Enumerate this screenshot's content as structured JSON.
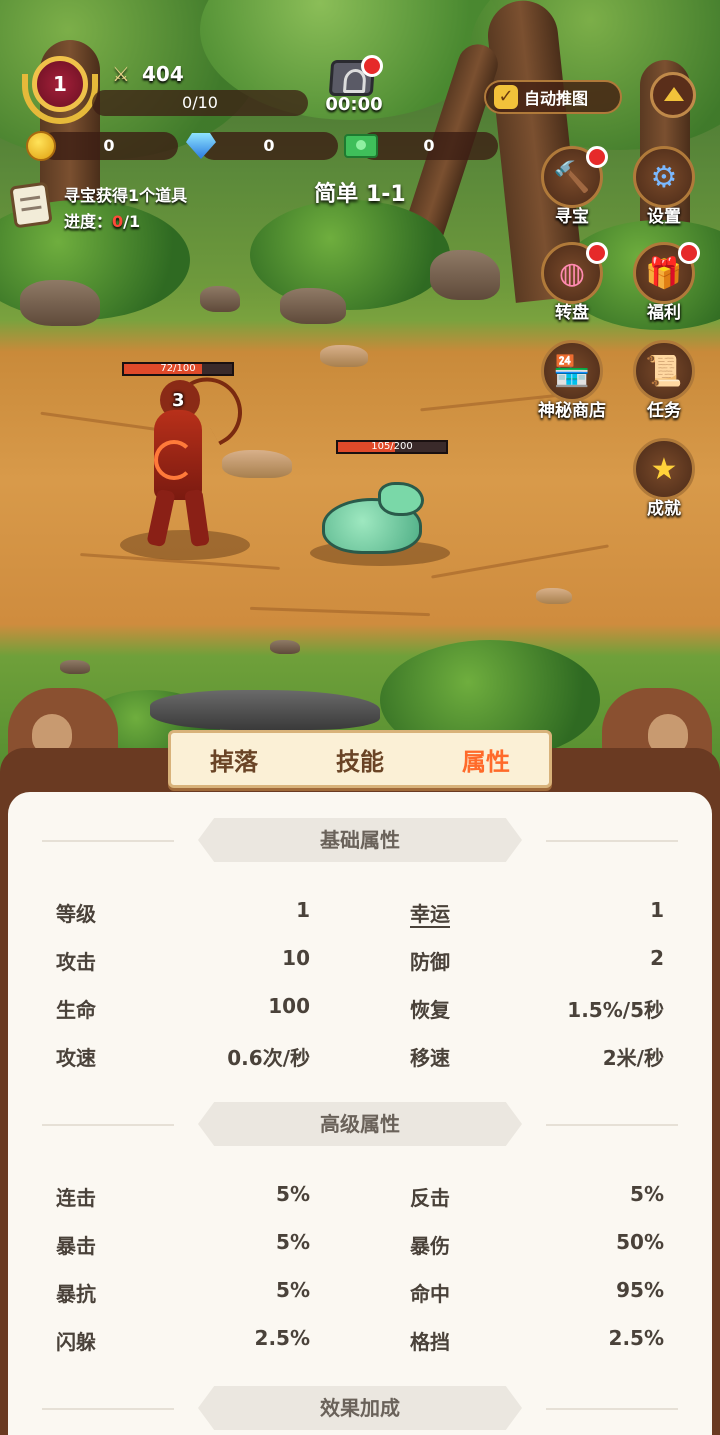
{
  "hud": {
    "level": "1",
    "power": "404",
    "xp": "0/10",
    "timer": "00:00",
    "auto_push_label": "自动推图",
    "currencies": {
      "gold": "0",
      "gems": "0",
      "cash": "0"
    },
    "quest": {
      "text": "寻宝获得1个道具",
      "progress_label": "进度：",
      "progress_current": "0",
      "progress_total": "/1"
    },
    "stage": "简单 1-1"
  },
  "side_menu": [
    {
      "label": "寻宝",
      "icon": "hammer-icon",
      "badge": true
    },
    {
      "label": "设置",
      "icon": "gear-icon",
      "badge": false
    },
    {
      "label": "转盘",
      "icon": "wheel-icon",
      "badge": true
    },
    {
      "label": "福利",
      "icon": "gift-icon",
      "badge": true
    },
    {
      "label": "神秘商店",
      "icon": "shop-icon",
      "badge": false
    },
    {
      "label": "任务",
      "icon": "scroll-icon",
      "badge": false
    },
    {
      "label": "成就",
      "icon": "star-icon",
      "badge": false
    }
  ],
  "battle": {
    "player_hp": "72/100",
    "player_hp_fraction": 0.72,
    "damage_number": "3",
    "enemy_hp": "105/200",
    "enemy_hp_fraction": 0.525
  },
  "tabs": {
    "drop": "掉落",
    "skill": "技能",
    "attr": "属性",
    "active": "属性"
  },
  "sections": {
    "basic": {
      "title": "基础属性",
      "rows": [
        {
          "k1": "等级",
          "v1": "1",
          "k2": "幸运",
          "v2": "1"
        },
        {
          "k1": "攻击",
          "v1": "10",
          "k2": "防御",
          "v2": "2"
        },
        {
          "k1": "生命",
          "v1": "100",
          "k2": "恢复",
          "v2": "1.5%/5秒"
        },
        {
          "k1": "攻速",
          "v1": "0.6次/秒",
          "k2": "移速",
          "v2": "2米/秒"
        }
      ]
    },
    "advanced": {
      "title": "高级属性",
      "rows": [
        {
          "k1": "连击",
          "v1": "5%",
          "k2": "反击",
          "v2": "5%"
        },
        {
          "k1": "暴击",
          "v1": "5%",
          "k2": "暴伤",
          "v2": "50%"
        },
        {
          "k1": "暴抗",
          "v1": "5%",
          "k2": "命中",
          "v2": "95%"
        },
        {
          "k1": "闪躲",
          "v1": "2.5%",
          "k2": "格挡",
          "v2": "2.5%"
        }
      ]
    },
    "bonus": {
      "title": "效果加成"
    }
  },
  "colors": {
    "accent": "#ff6a2a",
    "panel": "#6a3a22",
    "sheet": "#fbf8f2",
    "hp": "#e04a2a"
  }
}
